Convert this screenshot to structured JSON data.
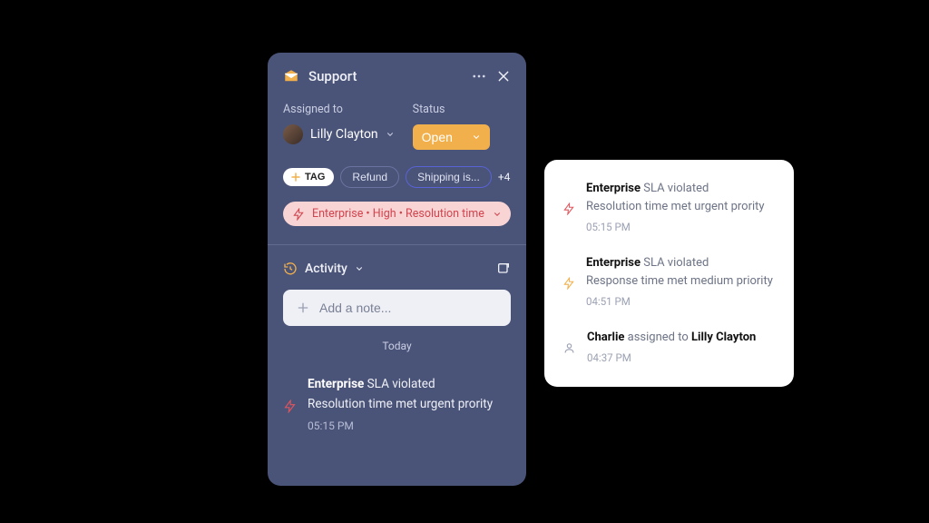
{
  "panel": {
    "title": "Support",
    "assigned_label": "Assigned to",
    "assignee_name": "Lilly Clayton",
    "status_label": "Status",
    "status_value": "Open",
    "tag_button": "TAG",
    "tags": [
      "Refund",
      "Shipping is..."
    ],
    "more_tags": "+4",
    "sla_summary": "Enterprise • High • Resolution time",
    "activity_title": "Activity",
    "note_placeholder": "Add a note...",
    "today_label": "Today",
    "item": {
      "title_bold": "Enterprise",
      "title_rest": " SLA violated",
      "subtitle": "Resolution time met urgent prority",
      "time": "05:15 PM"
    }
  },
  "popover": {
    "items": [
      {
        "icon": "bolt-red",
        "title_bold": "Enterprise",
        "title_rest": " SLA violated",
        "subtitle": "Resolution time met urgent prority",
        "time": "05:15 PM"
      },
      {
        "icon": "bolt-orange",
        "title_bold": "Enterprise",
        "title_rest": " SLA violated",
        "subtitle": "Response time met medium priority",
        "time": "04:51 PM"
      },
      {
        "icon": "person",
        "actor": "Charlie",
        "middle": " assigned to ",
        "target": "Lilly Clayton",
        "time": "04:37 PM"
      }
    ]
  }
}
